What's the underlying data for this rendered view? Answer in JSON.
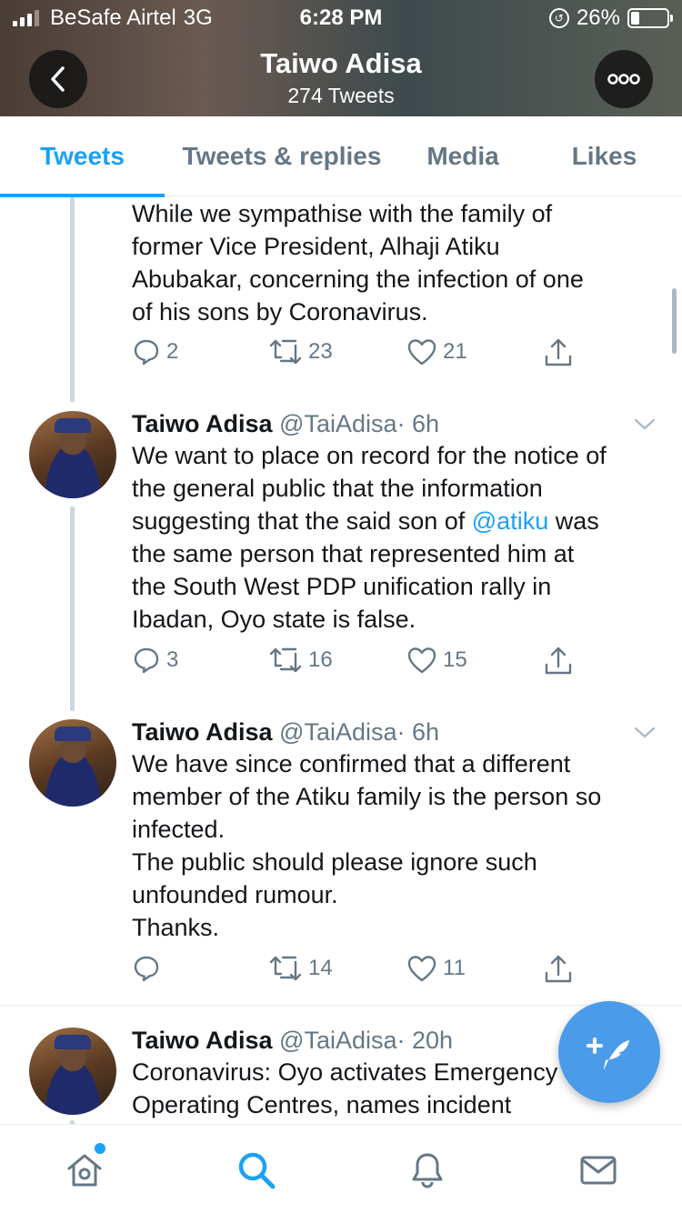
{
  "status_bar": {
    "carrier": "BeSafe Airtel",
    "network": "3G",
    "time": "6:28 PM",
    "battery": "26%",
    "battery_level": 0.26
  },
  "profile_header": {
    "name": "Taiwo Adisa",
    "tweet_count": "274 Tweets"
  },
  "tabs": [
    {
      "label": "Tweets",
      "active": true
    },
    {
      "label": "Tweets & replies",
      "active": false
    },
    {
      "label": "Media",
      "active": false
    },
    {
      "label": "Likes",
      "active": false
    }
  ],
  "tweets": [
    {
      "text": "While we sympathise with the family of\nformer Vice President, Alhaji Atiku\nAbubakar, concerning the infection of one\nof his sons by Coronavirus.",
      "replies": "2",
      "retweets": "23",
      "likes": "21"
    },
    {
      "author": "Taiwo Adisa",
      "handle": "@TaiAdisa",
      "time": "· 6h",
      "text_before": "We want to place on record for the notice of\nthe general public that the information\nsuggesting that the said son of ",
      "mention": "@atiku",
      "text_after": " was\nthe same person that represented him at\nthe South West PDP unification rally in\nIbadan, Oyo state is false.",
      "replies": "3",
      "retweets": "16",
      "likes": "15"
    },
    {
      "author": "Taiwo Adisa",
      "handle": "@TaiAdisa",
      "time": "· 6h",
      "text": "We have since confirmed that a different\nmember of the Atiku family is the person so\ninfected.\nThe public should please ignore such\nunfounded rumour.\nThanks.",
      "replies": "",
      "retweets": "14",
      "likes": "11"
    },
    {
      "author": "Taiwo Adisa",
      "handle": "@TaiAdisa",
      "time": "· 20h",
      "text": "Coronavirus: Oyo activates Emergency\nOperating Centres, names incident"
    }
  ],
  "icons": {
    "back": "chevron-left-icon",
    "more": "more-dots-icon",
    "reply": "reply-icon",
    "retweet": "retweet-icon",
    "like": "heart-icon",
    "share": "share-icon",
    "compose": "compose-tweet-icon",
    "home": "home-icon",
    "search": "search-icon",
    "notifications": "bell-icon",
    "messages": "mail-icon"
  },
  "colors": {
    "accent": "#1da1f2",
    "muted": "#657786",
    "fab": "#4a9bea"
  }
}
